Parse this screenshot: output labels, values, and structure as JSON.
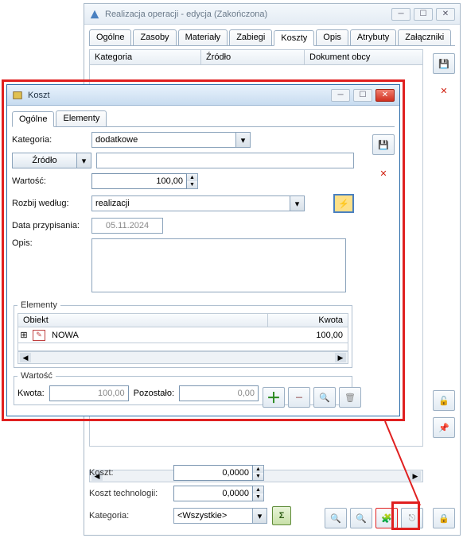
{
  "parent": {
    "title": "Realizacja operacji - edycja (Zakończona)",
    "tabs": [
      "Ogólne",
      "Zasoby",
      "Materiały",
      "Zabiegi",
      "Koszty",
      "Opis",
      "Atrybuty",
      "Załączniki"
    ],
    "active_tab": 4,
    "list_cols": {
      "kategoria": "Kategoria",
      "zrodlo": "Źródło",
      "dokument": "Dokument obcy"
    },
    "footer": {
      "koszt_label": "Koszt:",
      "koszt_value": "0,0000",
      "koszt_tech_label": "Koszt technologii:",
      "koszt_tech_value": "0,0000",
      "kategoria_label": "Kategoria:",
      "kategoria_value": "<Wszystkie>"
    }
  },
  "dialog": {
    "title": "Koszt",
    "tabs": [
      "Ogólne",
      "Elementy"
    ],
    "active_tab": 0,
    "form": {
      "kategoria_label": "Kategoria:",
      "kategoria_value": "dodatkowe",
      "zrodlo_label": "Źródło",
      "zrodlo_value": "",
      "wartosc_label": "Wartość:",
      "wartosc_value": "100,00",
      "rozbij_label": "Rozbij według:",
      "rozbij_value": "realizacji",
      "data_label": "Data przypisania:",
      "data_value": "05.11.2024",
      "opis_label": "Opis:",
      "opis_value": ""
    },
    "elementy": {
      "legend": "Elementy",
      "cols": {
        "obiekt": "Obiekt",
        "kwota": "Kwota"
      },
      "rows": [
        {
          "obiekt": "NOWA",
          "kwota": "100,00"
        }
      ]
    },
    "wartosc_group": {
      "legend": "Wartość",
      "kwota_label": "Kwota:",
      "kwota_value": "100,00",
      "pozostalo_label": "Pozostało:",
      "pozostalo_value": "0,00"
    }
  },
  "icons": {
    "minimize": "─",
    "maximize": "☐",
    "close": "✕",
    "save": "💾",
    "delete": "✕",
    "chevron": "▾",
    "up": "▲",
    "down": "▼",
    "left": "◀",
    "right": "▶",
    "sigma": "Σ",
    "bolt": "⚡",
    "plus": "＋",
    "minus": "－",
    "search": "🔍",
    "trash": "🗑",
    "unlock": "🔓",
    "pin": "📌",
    "puzzle": "🧩",
    "link": "⎋",
    "lock": "🔒",
    "expand": "⊞"
  }
}
